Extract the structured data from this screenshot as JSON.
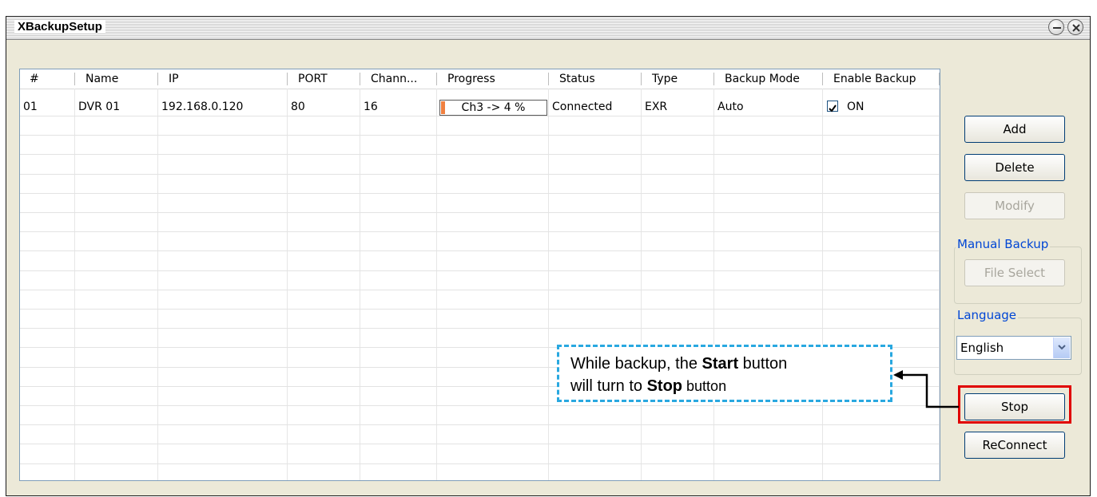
{
  "window": {
    "title": "XBackupSetup"
  },
  "table": {
    "columns": [
      "#",
      "Name",
      "IP",
      "PORT",
      "Chann...",
      "Progress",
      "Status",
      "Type",
      "Backup Mode",
      "Enable Backup"
    ],
    "rows": [
      {
        "num": "01",
        "name": "DVR 01",
        "ip": "192.168.0.120",
        "port": "80",
        "channels": "16",
        "progress_text": "Ch3 -> 4 %",
        "progress_percent": 4,
        "status": "Connected",
        "type": "EXR",
        "backup_mode": "Auto",
        "enable_backup_checked": true,
        "enable_backup_label": "ON"
      }
    ]
  },
  "buttons": {
    "add": "Add",
    "delete": "Delete",
    "modify": "Modify",
    "stop": "Stop",
    "reconnect": "ReConnect"
  },
  "manual_backup": {
    "label": "Manual Backup",
    "file_select": "File Select"
  },
  "language": {
    "label": "Language",
    "selected": "English"
  },
  "callout": {
    "line1_prefix": "While backup, the ",
    "line1_bold": "Start",
    "line1_suffix": " button",
    "line2_prefix": "will turn to ",
    "line2_bold": "Stop",
    "line2_suffix": " button"
  },
  "colors": {
    "highlight": "#e00000",
    "callout_border": "#29a8e0",
    "progress_fill": "#f08040",
    "group_label": "#0046d5"
  }
}
